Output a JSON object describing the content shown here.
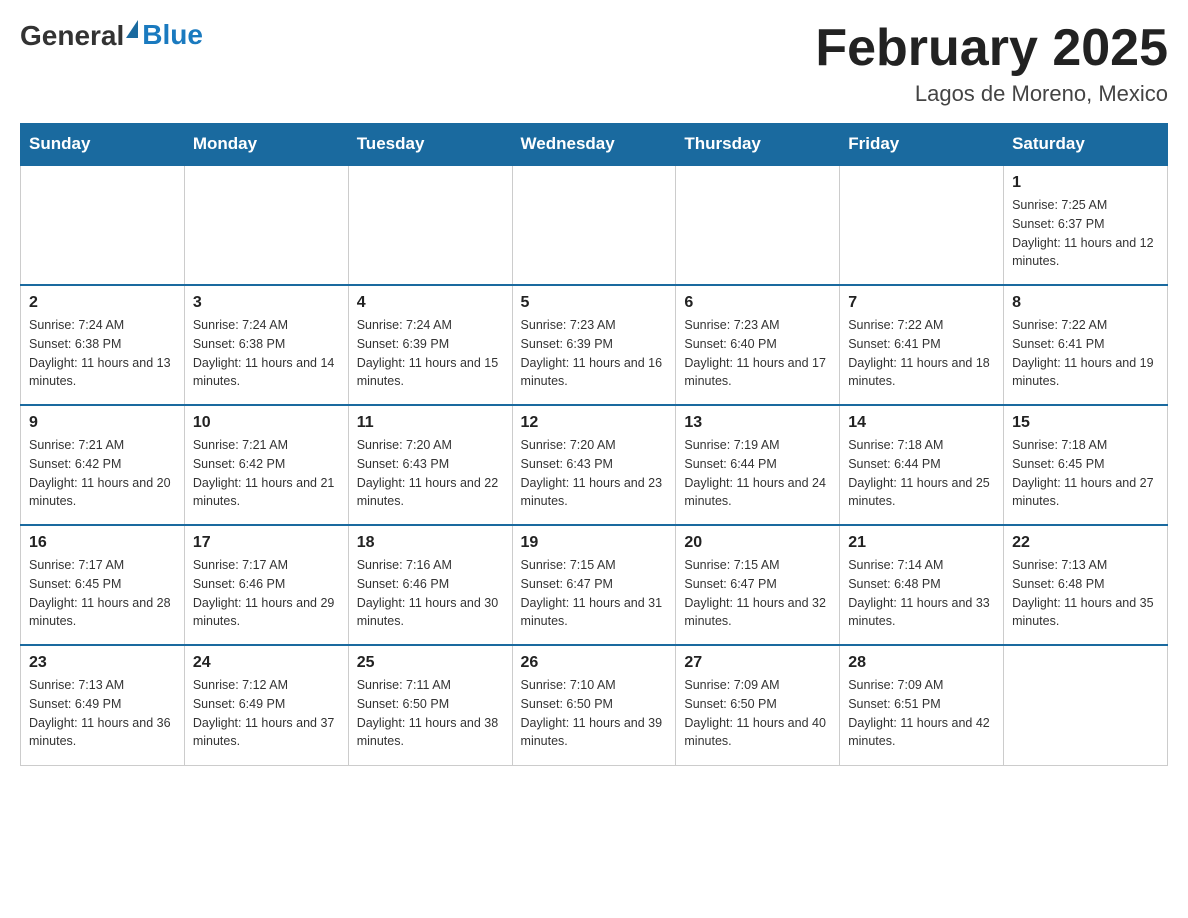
{
  "header": {
    "logo": {
      "text_general": "General",
      "text_blue": "Blue",
      "alt": "GeneralBlue logo"
    },
    "title": "February 2025",
    "location": "Lagos de Moreno, Mexico"
  },
  "calendar": {
    "days_of_week": [
      "Sunday",
      "Monday",
      "Tuesday",
      "Wednesday",
      "Thursday",
      "Friday",
      "Saturday"
    ],
    "weeks": [
      [
        {
          "day": "",
          "info": ""
        },
        {
          "day": "",
          "info": ""
        },
        {
          "day": "",
          "info": ""
        },
        {
          "day": "",
          "info": ""
        },
        {
          "day": "",
          "info": ""
        },
        {
          "day": "",
          "info": ""
        },
        {
          "day": "1",
          "info": "Sunrise: 7:25 AM\nSunset: 6:37 PM\nDaylight: 11 hours and 12 minutes."
        }
      ],
      [
        {
          "day": "2",
          "info": "Sunrise: 7:24 AM\nSunset: 6:38 PM\nDaylight: 11 hours and 13 minutes."
        },
        {
          "day": "3",
          "info": "Sunrise: 7:24 AM\nSunset: 6:38 PM\nDaylight: 11 hours and 14 minutes."
        },
        {
          "day": "4",
          "info": "Sunrise: 7:24 AM\nSunset: 6:39 PM\nDaylight: 11 hours and 15 minutes."
        },
        {
          "day": "5",
          "info": "Sunrise: 7:23 AM\nSunset: 6:39 PM\nDaylight: 11 hours and 16 minutes."
        },
        {
          "day": "6",
          "info": "Sunrise: 7:23 AM\nSunset: 6:40 PM\nDaylight: 11 hours and 17 minutes."
        },
        {
          "day": "7",
          "info": "Sunrise: 7:22 AM\nSunset: 6:41 PM\nDaylight: 11 hours and 18 minutes."
        },
        {
          "day": "8",
          "info": "Sunrise: 7:22 AM\nSunset: 6:41 PM\nDaylight: 11 hours and 19 minutes."
        }
      ],
      [
        {
          "day": "9",
          "info": "Sunrise: 7:21 AM\nSunset: 6:42 PM\nDaylight: 11 hours and 20 minutes."
        },
        {
          "day": "10",
          "info": "Sunrise: 7:21 AM\nSunset: 6:42 PM\nDaylight: 11 hours and 21 minutes."
        },
        {
          "day": "11",
          "info": "Sunrise: 7:20 AM\nSunset: 6:43 PM\nDaylight: 11 hours and 22 minutes."
        },
        {
          "day": "12",
          "info": "Sunrise: 7:20 AM\nSunset: 6:43 PM\nDaylight: 11 hours and 23 minutes."
        },
        {
          "day": "13",
          "info": "Sunrise: 7:19 AM\nSunset: 6:44 PM\nDaylight: 11 hours and 24 minutes."
        },
        {
          "day": "14",
          "info": "Sunrise: 7:18 AM\nSunset: 6:44 PM\nDaylight: 11 hours and 25 minutes."
        },
        {
          "day": "15",
          "info": "Sunrise: 7:18 AM\nSunset: 6:45 PM\nDaylight: 11 hours and 27 minutes."
        }
      ],
      [
        {
          "day": "16",
          "info": "Sunrise: 7:17 AM\nSunset: 6:45 PM\nDaylight: 11 hours and 28 minutes."
        },
        {
          "day": "17",
          "info": "Sunrise: 7:17 AM\nSunset: 6:46 PM\nDaylight: 11 hours and 29 minutes."
        },
        {
          "day": "18",
          "info": "Sunrise: 7:16 AM\nSunset: 6:46 PM\nDaylight: 11 hours and 30 minutes."
        },
        {
          "day": "19",
          "info": "Sunrise: 7:15 AM\nSunset: 6:47 PM\nDaylight: 11 hours and 31 minutes."
        },
        {
          "day": "20",
          "info": "Sunrise: 7:15 AM\nSunset: 6:47 PM\nDaylight: 11 hours and 32 minutes."
        },
        {
          "day": "21",
          "info": "Sunrise: 7:14 AM\nSunset: 6:48 PM\nDaylight: 11 hours and 33 minutes."
        },
        {
          "day": "22",
          "info": "Sunrise: 7:13 AM\nSunset: 6:48 PM\nDaylight: 11 hours and 35 minutes."
        }
      ],
      [
        {
          "day": "23",
          "info": "Sunrise: 7:13 AM\nSunset: 6:49 PM\nDaylight: 11 hours and 36 minutes."
        },
        {
          "day": "24",
          "info": "Sunrise: 7:12 AM\nSunset: 6:49 PM\nDaylight: 11 hours and 37 minutes."
        },
        {
          "day": "25",
          "info": "Sunrise: 7:11 AM\nSunset: 6:50 PM\nDaylight: 11 hours and 38 minutes."
        },
        {
          "day": "26",
          "info": "Sunrise: 7:10 AM\nSunset: 6:50 PM\nDaylight: 11 hours and 39 minutes."
        },
        {
          "day": "27",
          "info": "Sunrise: 7:09 AM\nSunset: 6:50 PM\nDaylight: 11 hours and 40 minutes."
        },
        {
          "day": "28",
          "info": "Sunrise: 7:09 AM\nSunset: 6:51 PM\nDaylight: 11 hours and 42 minutes."
        },
        {
          "day": "",
          "info": ""
        }
      ]
    ]
  }
}
